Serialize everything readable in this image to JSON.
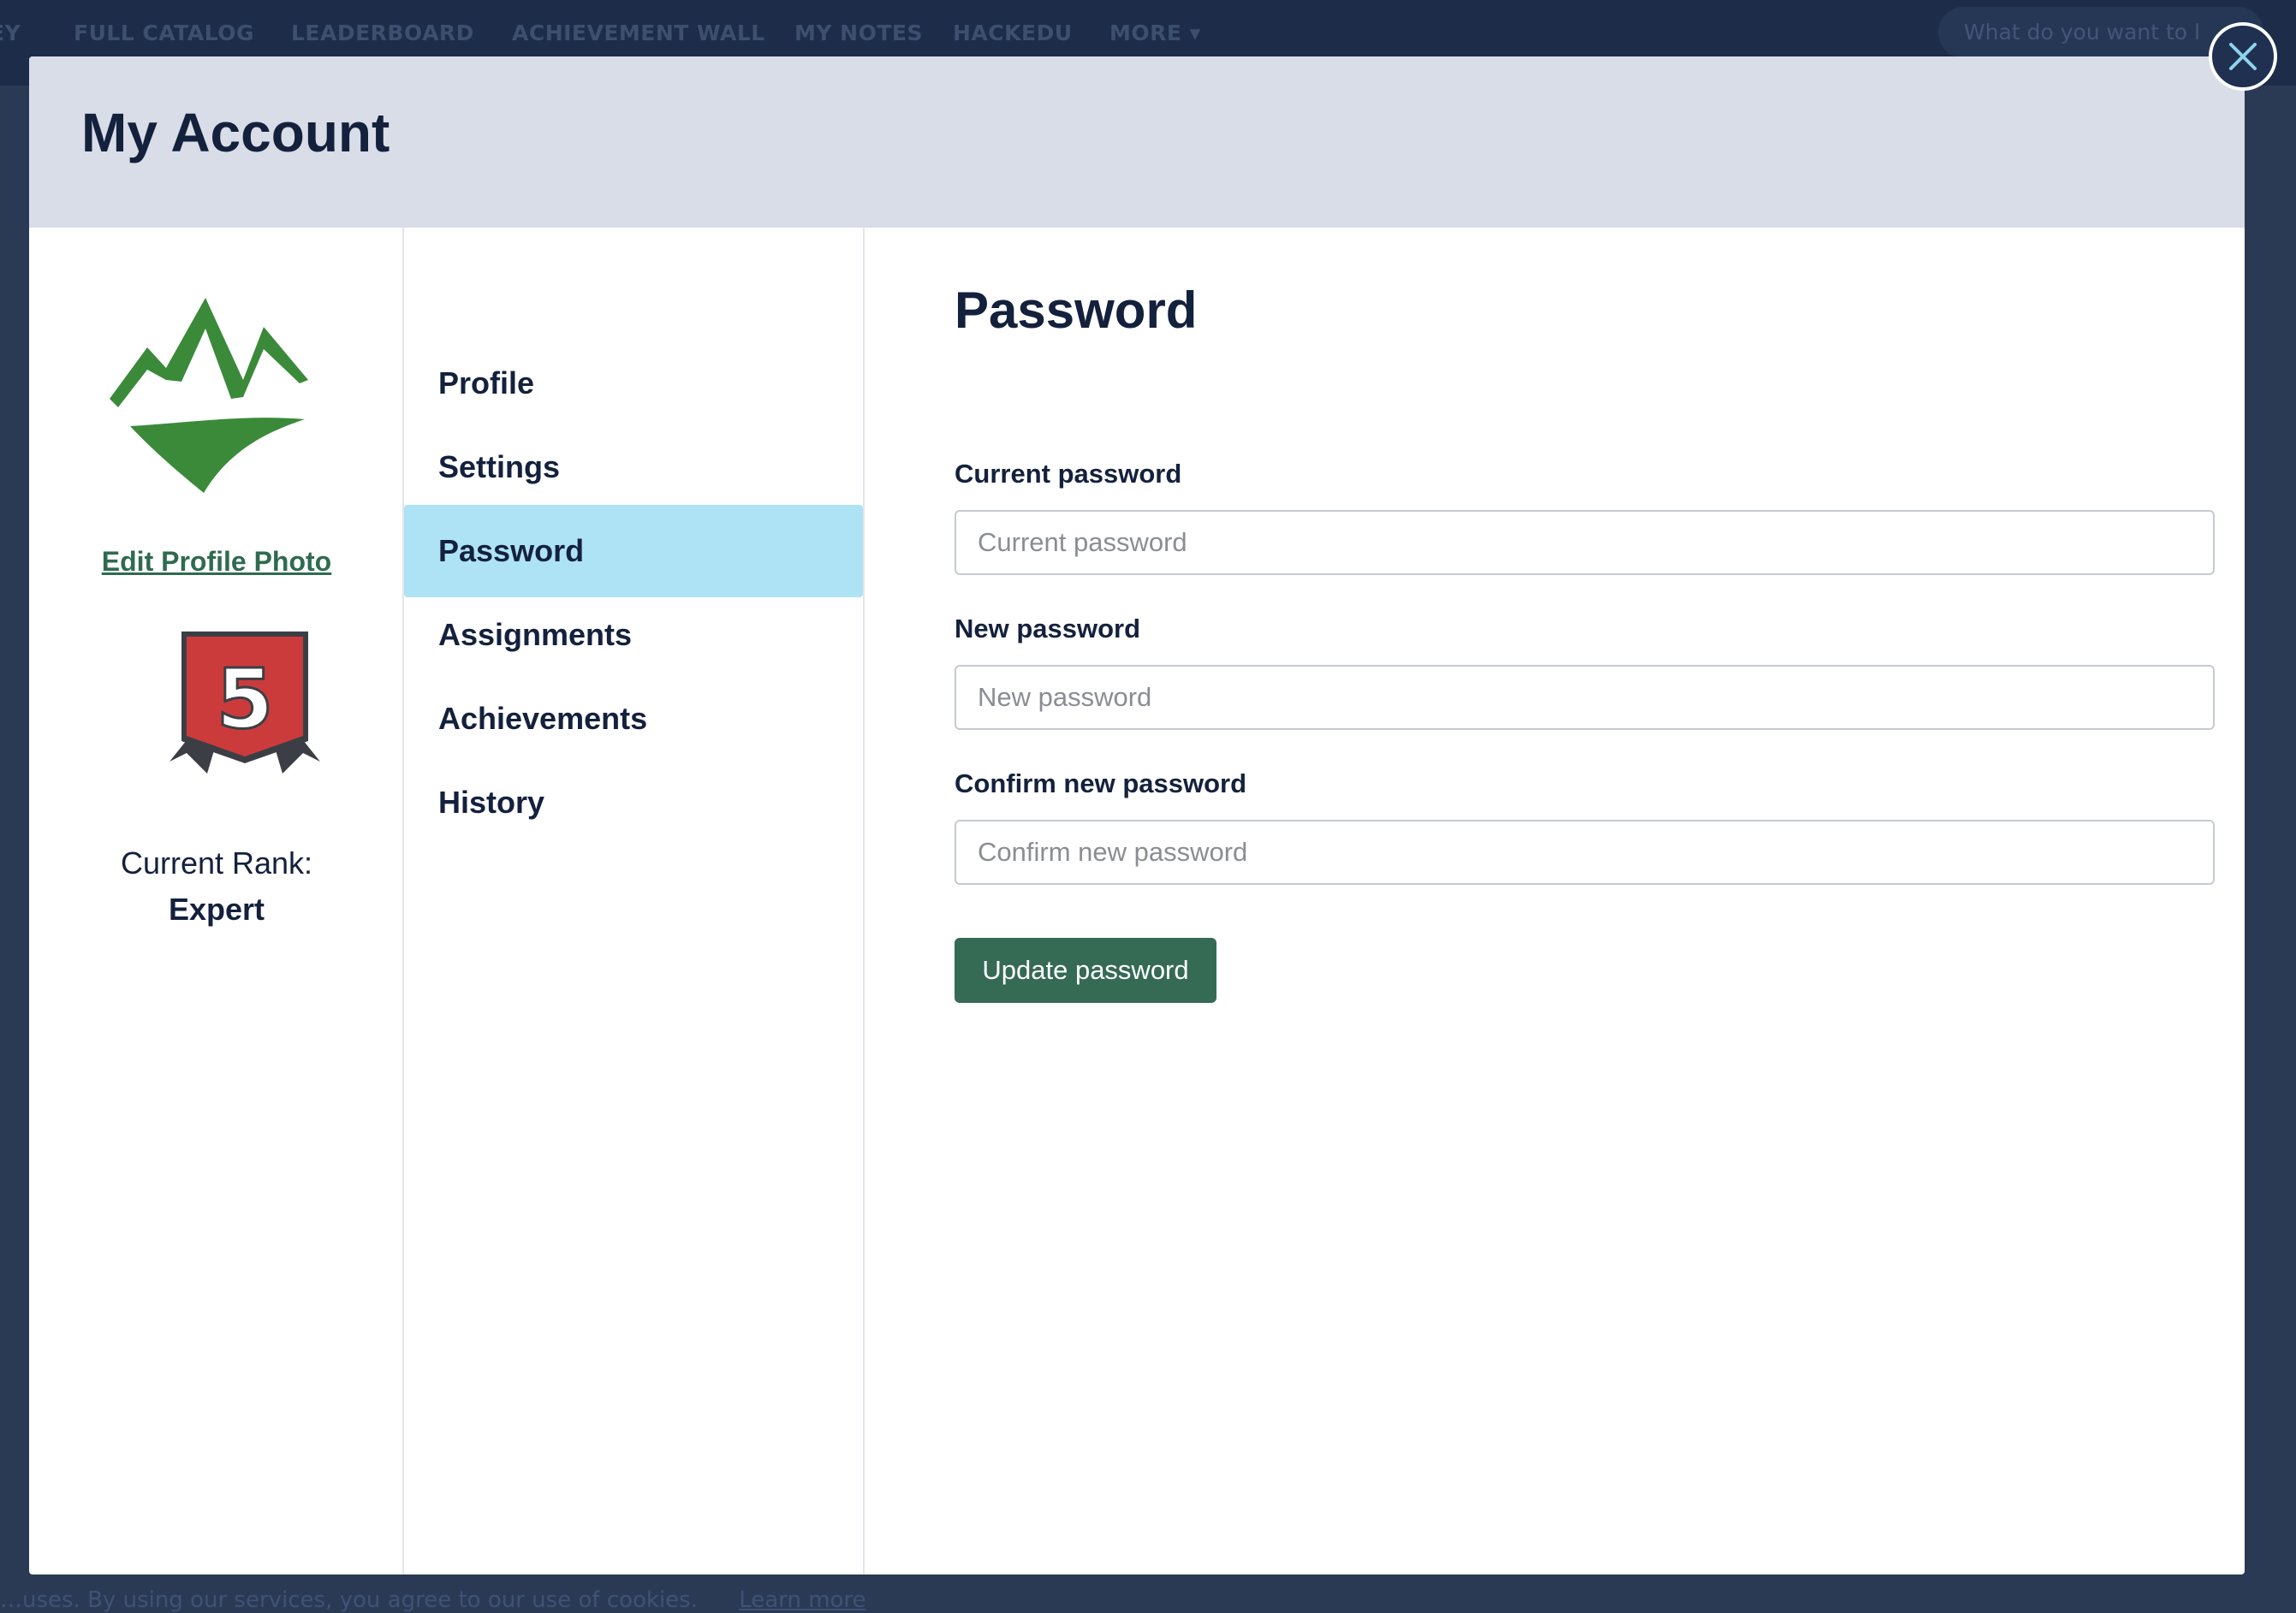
{
  "background_nav": {
    "items": [
      "FULL CATALOG",
      "LEADERBOARD",
      "ACHIEVEMENT WALL",
      "MY NOTES",
      "HACKEDU",
      "MORE ▾"
    ],
    "search_placeholder": "What do you want to l",
    "cookie_text": "…uses. By using our services, you agree to our use of cookies.",
    "cookie_link": "Learn more"
  },
  "modal": {
    "title": "My Account",
    "close_icon": "close-icon"
  },
  "profile": {
    "avatar_icon": "mountain-logo-icon",
    "edit_photo_label": "Edit Profile Photo",
    "rank_badge_number": "5",
    "rank_label": "Current Rank:",
    "rank_value": "Expert"
  },
  "nav": {
    "items": [
      {
        "label": "Profile"
      },
      {
        "label": "Settings"
      },
      {
        "label": "Password",
        "active": true
      },
      {
        "label": "Assignments"
      },
      {
        "label": "Achievements"
      },
      {
        "label": "History"
      }
    ]
  },
  "password": {
    "title": "Password",
    "current_label": "Current password",
    "current_placeholder": "Current password",
    "new_label": "New password",
    "new_placeholder": "New password",
    "confirm_label": "Confirm new password",
    "confirm_placeholder": "Confirm new password",
    "submit_label": "Update password"
  },
  "colors": {
    "accent_button": "#356a55",
    "active_nav": "#aee3f6",
    "header_bg": "#d9dde8",
    "brand_green": "#3a8a3a",
    "badge_red": "#cc3b3b"
  }
}
